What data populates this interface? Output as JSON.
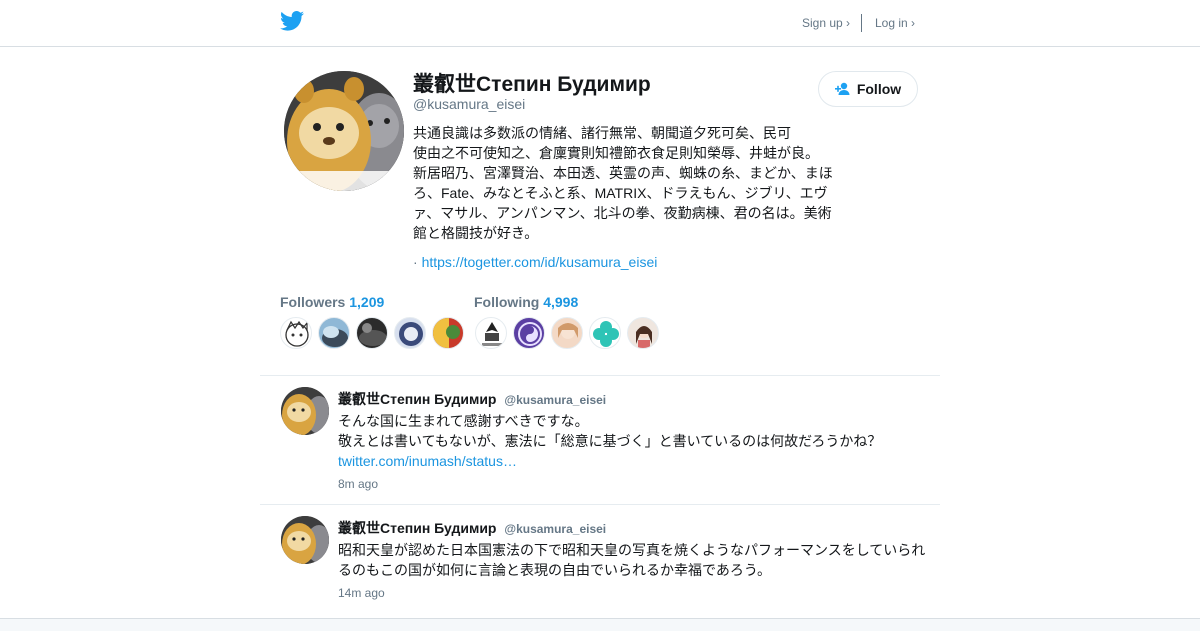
{
  "header": {
    "signup_label": "Sign up ›",
    "login_label": "Log in ›",
    "logo_icon": "twitter-bird-icon"
  },
  "profile": {
    "name": "叢叡世Степин Будимир",
    "handle": "@kusamura_eisei",
    "follow_label": "Follow",
    "bio_lines": [
      "共通良識は多数派の情緒、諸行無常、朝聞道夕死可矣、民可",
      "使由之不可使知之、倉廩實則知禮節衣食足則知榮辱、井蛙が良。",
      "新居昭乃、宮澤賢治、本田透、英霊の声、蜘蛛の糸、まどか、まほ",
      "ろ、Fate、みなとそふと系、MATRIX、ドラえもん、ジブリ、エヴ",
      "ァ、マサル、アンパンマン、北斗の拳、夜勤病棟、君の名は。美術",
      "館と格闘技が好き。"
    ],
    "url_prefix": "·",
    "url": "https://togetter.com/id/kusamura_eisei"
  },
  "stats": {
    "followers_label": "Followers",
    "followers_count": "1,209",
    "following_label": "Following",
    "following_count": "4,998"
  },
  "tweets": [
    {
      "name": "叢叡世Степин Будимир",
      "handle": "@kusamura_eisei",
      "lines": [
        "そんな国に生まれて感謝すべきですな。",
        "敬えとは書いてもないが、憲法に「総意に基づく」と書いているのは何故だろうかね？"
      ],
      "link": "twitter.com/inumash/status…",
      "time": "8m ago"
    },
    {
      "name": "叢叡世Степин Будимир",
      "handle": "@kusamura_eisei",
      "lines": [
        "昭和天皇が認めた日本国憲法の下で昭和天皇の写真を焼くようなパフォーマンスをしていられ",
        "るのもこの国が如何に言論と表現の自由でいられるか幸福であろう。"
      ],
      "time": "14m ago"
    }
  ],
  "colors": {
    "brand": "#1da1f2",
    "link": "#1b95e0",
    "muted": "#657786",
    "text": "#14171a"
  }
}
